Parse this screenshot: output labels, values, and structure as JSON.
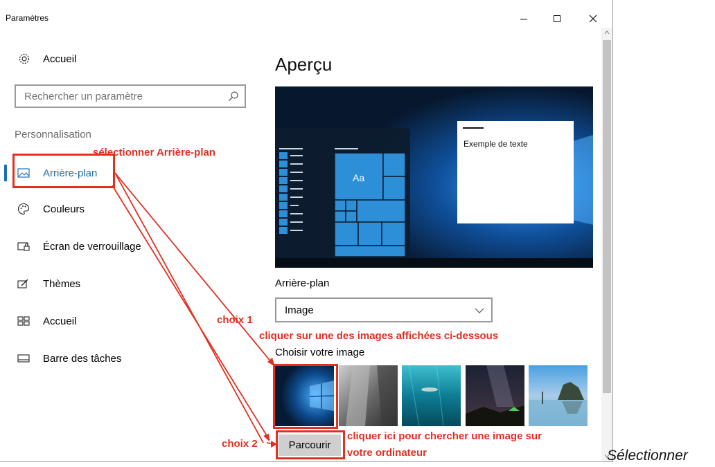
{
  "window": {
    "title": "Paramètres"
  },
  "nav": {
    "home_label": "Accueil",
    "search_placeholder": "Rechercher un paramètre",
    "section_title": "Personnalisation",
    "items": [
      {
        "label": "Arrière-plan",
        "icon": "picture-icon",
        "active": true
      },
      {
        "label": "Couleurs",
        "icon": "palette-icon",
        "active": false
      },
      {
        "label": "Écran de verrouillage",
        "icon": "lock-screen-icon",
        "active": false
      },
      {
        "label": "Thèmes",
        "icon": "themes-icon",
        "active": false
      },
      {
        "label": "Accueil",
        "icon": "start-icon",
        "active": false
      },
      {
        "label": "Barre des tâches",
        "icon": "taskbar-icon",
        "active": false
      }
    ]
  },
  "main": {
    "heading": "Aperçu",
    "preview": {
      "tile_label": "Aa",
      "sample_text": "Exemple de texte"
    },
    "background_label": "Arrière-plan",
    "background_select": "Image",
    "choose_label": "Choisir votre image",
    "thumbnails": [
      "windows-hero",
      "rock-cliff",
      "underwater-swimmer",
      "night-sky-tent",
      "beach-rocks"
    ],
    "browse_label": "Parcourir"
  },
  "annotations": {
    "select_bg": "sélectionner Arrière-plan",
    "choice1": "choix 1",
    "choice1_text": "cliquer sur une des images affichées ci-dessous",
    "choice2": "choix 2",
    "choice2_text_line1": "cliquer ici pour chercher une image sur",
    "choice2_text_line2": "votre ordinateur",
    "color": "#e03020"
  },
  "caption": "Sélectionner"
}
